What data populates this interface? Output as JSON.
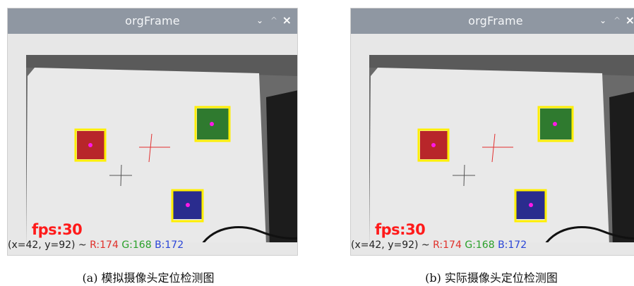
{
  "panels": [
    {
      "window_title": "orgFrame",
      "buttons": {
        "minimize": "⌄",
        "maximize": "^",
        "close": "×"
      },
      "fps_text": "fps:30",
      "status": {
        "coords": "(x=42, y=92) ~ ",
        "r": "R:174",
        "g": "G:168",
        "b": "B:172"
      },
      "caption": "(a)  模拟摄像头定位检测图"
    },
    {
      "window_title": "orgFrame",
      "buttons": {
        "minimize": "⌄",
        "maximize": "^",
        "close": "×"
      },
      "fps_text": "fps:30",
      "status": {
        "coords": "(x=42, y=92) ~ ",
        "r": "R:174",
        "g": "G:168",
        "b": "B:172"
      },
      "caption": "(b)  实际摄像头定位检测图"
    }
  ],
  "colors": {
    "detection_box": "#ffef00",
    "center_marker": "#ff18e8",
    "red_block": "#b8262a",
    "green_block": "#2f7a2f",
    "blue_block": "#2a2c8e",
    "fps_text": "#ff1a1a"
  },
  "icons": [
    "chevron-down-icon",
    "chevron-up-icon",
    "close-icon",
    "crosshair-icon"
  ]
}
